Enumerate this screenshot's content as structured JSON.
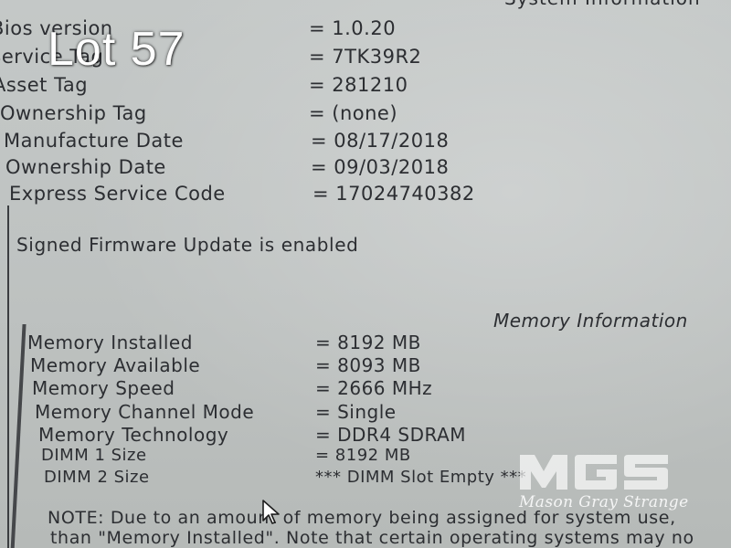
{
  "header": {
    "system_information_title": "System Information"
  },
  "system_info": [
    {
      "label": "Bios version",
      "value": "= 1.0.20"
    },
    {
      "label": "Service Tag",
      "value": "= 7TK39R2"
    },
    {
      "label": "Asset Tag",
      "value": "= 281210"
    },
    {
      "label": "Ownership Tag",
      "value": "= (none)"
    },
    {
      "label": "Manufacture Date",
      "value": "= 08/17/2018"
    },
    {
      "label": "Ownership Date",
      "value": "= 09/03/2018"
    },
    {
      "label": "Express Service Code",
      "value": "= 17024740382"
    }
  ],
  "signed_firmware": "Signed Firmware Update is enabled",
  "memory": {
    "title": "Memory Information",
    "rows": [
      {
        "label": "Memory Installed",
        "value": "= 8192 MB"
      },
      {
        "label": "Memory Available",
        "value": "= 8093 MB"
      },
      {
        "label": "Memory Speed",
        "value": "= 2666 MHz"
      },
      {
        "label": "Memory Channel Mode",
        "value": "= Single"
      },
      {
        "label": "Memory Technology",
        "value": "= DDR4 SDRAM"
      },
      {
        "label": "DIMM 1 Size",
        "value": "= 8192 MB"
      },
      {
        "label": "DIMM 2 Size",
        "value": "*** DIMM Slot Empty ***"
      }
    ]
  },
  "note": {
    "line1": "NOTE: Due to an amount of memory being assigned for system use,",
    "line2": "than \"Memory Installed\". Note that certain operating systems may no"
  },
  "overlay": {
    "lot_label": "Lot 57",
    "watermark_logo": "MGS",
    "watermark_tagline": "Mason Gray Strange"
  },
  "colors": {
    "screen_text": "#2c2e32",
    "screen_background": "#c0c4c3",
    "overlay_text": "#ffffff"
  }
}
